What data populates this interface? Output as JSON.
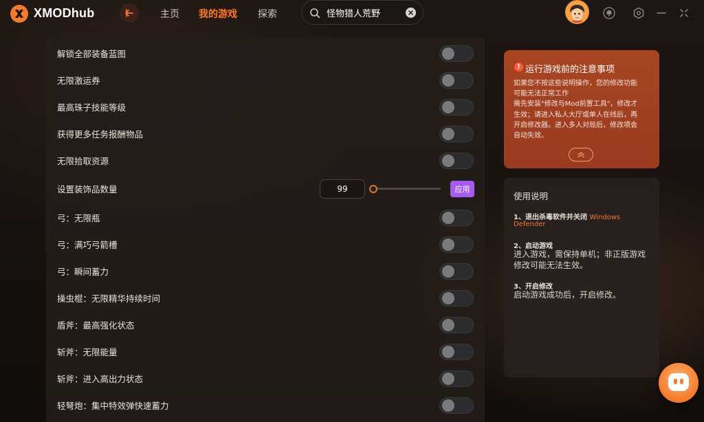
{
  "app": {
    "brand": "XMODhub",
    "nav": [
      {
        "label": "主页"
      },
      {
        "label": "我的游戏"
      },
      {
        "label": "探索"
      }
    ],
    "search": {
      "value": "怪物猎人荒野",
      "placeholder": ""
    },
    "accent": "#ff7a2a"
  },
  "mods": [
    {
      "label": "解锁全部装备蓝图",
      "on": false
    },
    {
      "label": "无限激运券",
      "on": false
    },
    {
      "label": "最高珠子技能等级",
      "on": false
    },
    {
      "label": "获得更多任务报酬物品",
      "on": false
    },
    {
      "label": "无限拾取资源",
      "on": false
    }
  ],
  "numeric_mod": {
    "label": "设置装饰品数量",
    "value": "99",
    "apply_label": "应用",
    "slider_fraction": 0.0
  },
  "mods2": [
    {
      "label": "弓：无限瓶",
      "on": false
    },
    {
      "label": "弓：满巧弓箭槽",
      "on": false
    },
    {
      "label": "弓：瞬间蓄力",
      "on": false
    },
    {
      "label": "操虫棍：无限精华持续时间",
      "on": false
    },
    {
      "label": "盾斧：最高强化状态",
      "on": false
    },
    {
      "label": "斩斧：无限能量",
      "on": false
    },
    {
      "label": "斩斧：进入高出力状态",
      "on": false
    },
    {
      "label": "轻弩炮：集中特效弹快速蓄力",
      "on": false
    }
  ],
  "notice": {
    "title": "运行游戏前的注意事项",
    "icon": "!",
    "body_lines": [
      "如果您不按这些说明操作，您的修改功能",
      "可能无法正常工作",
      "需先安装\"修改与Mod前置工具\"，修改才",
      "生效；请进入私人大厅或单人在线后，再",
      "开启修改器。进入多人对局后，修改项会",
      "自动失效。"
    ]
  },
  "guide": {
    "title": "使用说明",
    "step1_head": "1、退出杀毒软件并关闭",
    "step1_link_a": "Windows",
    "step1_link_b": "Defender",
    "step2_head": "2、启动游戏",
    "step2_body": "进入游戏，需保持单机；非正版游戏修改可能无法生效。",
    "step3_head": "3、开启修改",
    "step3_body": "启动游戏成功后，开启修改。"
  }
}
